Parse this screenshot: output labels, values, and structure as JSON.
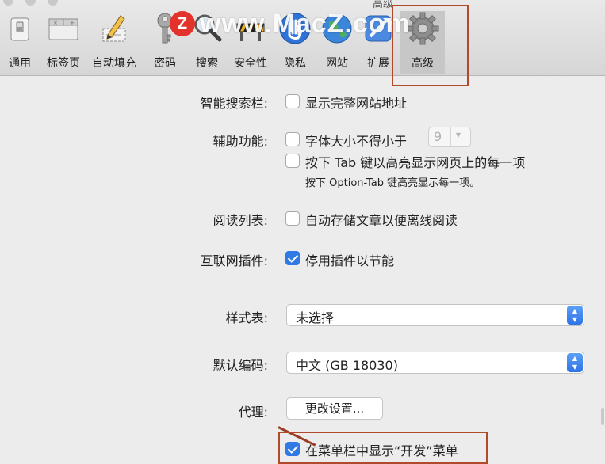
{
  "window": {
    "title": "高级"
  },
  "watermark": {
    "logo": "Z",
    "text": "www.MacZ.com"
  },
  "toolbar": {
    "items": [
      {
        "label": "通用",
        "icon": "switch-icon"
      },
      {
        "label": "标签页",
        "icon": "tabs-icon"
      },
      {
        "label": "自动填充",
        "icon": "pencil-form-icon"
      },
      {
        "label": "密码",
        "icon": "key-icon"
      },
      {
        "label": "搜索",
        "icon": "magnifier-icon"
      },
      {
        "label": "安全性",
        "icon": "caution-sign-icon"
      },
      {
        "label": "隐私",
        "icon": "hand-icon"
      },
      {
        "label": "网站",
        "icon": "globe-icon"
      },
      {
        "label": "扩展",
        "icon": "puzzle-icon"
      },
      {
        "label": "高级",
        "icon": "gear-icon",
        "selected": true
      }
    ]
  },
  "smart_search": {
    "label": "智能搜索栏:",
    "show_full_address": {
      "text": "显示完整网站地址",
      "checked": false
    }
  },
  "accessibility": {
    "label": "辅助功能:",
    "min_font_size": {
      "text": "字体大小不得小于",
      "checked": false,
      "value": "9"
    },
    "tab_highlight": {
      "text": "按下 Tab 键以高亮显示网页上的每一项",
      "checked": false
    },
    "note": "按下 Option-Tab 键高亮显示每一项。"
  },
  "reading_list": {
    "label": "阅读列表:",
    "save_offline": {
      "text": "自动存储文章以便离线阅读",
      "checked": false
    }
  },
  "plugins": {
    "label": "互联网插件:",
    "stop_plugins": {
      "text": "停用插件以节能",
      "checked": true
    }
  },
  "stylesheet": {
    "label": "样式表:",
    "value": "未选择"
  },
  "encoding": {
    "label": "默认编码:",
    "value": "中文 (GB 18030)"
  },
  "proxies": {
    "label": "代理:",
    "button": "更改设置..."
  },
  "develop_menu": {
    "text": "在菜单栏中显示“开发”菜单",
    "checked": true
  },
  "colors": {
    "accent": "#2f7ae5",
    "annotation": "#b04a2a",
    "watermark_logo": "#e3322c"
  }
}
